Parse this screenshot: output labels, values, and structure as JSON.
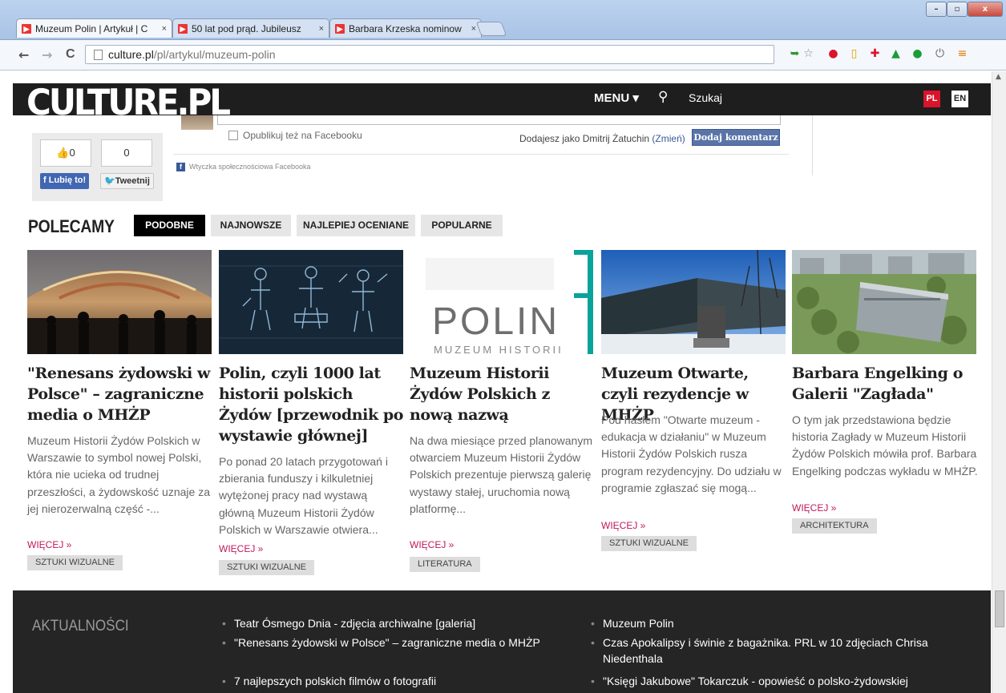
{
  "browser": {
    "tabs": [
      {
        "title": "Muzeum Polin | Artykuł | C",
        "close": "×"
      },
      {
        "title": "50 lat pod prąd. Jubileusz",
        "close": "×"
      },
      {
        "title": "Barbara Krzeska nominow",
        "close": "×"
      }
    ],
    "window_buttons": {
      "minimize": "–",
      "maximize": "▫",
      "close": "x"
    },
    "url": {
      "host": "culture.pl",
      "path": "/pl/artykul/muzeum-polin"
    },
    "nav": {
      "back": "←",
      "forward": "→",
      "reload": "C"
    }
  },
  "site": {
    "logo": "CULTURE.PL",
    "menu_label": "MENU ▾",
    "search_label": "Szukaj",
    "lang_pl": "PL",
    "lang_en": "EN"
  },
  "comments": {
    "facebook_checkbox_label": "Opublikuj też na Facebooku",
    "adding_as": "Dodajesz jako Dmitrij Żatuchin",
    "change_link": "(Zmień)",
    "submit_button": "Dodaj komentarz",
    "plugin_note": "Wtyczka społecznościowa Facebooka"
  },
  "share": {
    "likes_count": "0",
    "tweets_count": "0",
    "like_button": "Lubię to!",
    "tweet_button": "Tweetnij"
  },
  "recommended": {
    "heading": "POLECAMY",
    "tabs": [
      {
        "label": "PODOBNE"
      },
      {
        "label": "NAJNOWSZE"
      },
      {
        "label": "NAJLEPIEJ OCENIANE"
      },
      {
        "label": "POPULARNE"
      }
    ],
    "active_tab": "PODOBNE",
    "cards": [
      {
        "title": "\"Renesans żydowski w Polsce\" – zagraniczne media o MHŻP",
        "description": "Muzeum Historii Żydów Polskich w Warszawie to symbol nowej Polski, która nie ucieka od trudnej przeszłości, a żydowskość uznaje za jej nierozerwalną część -...",
        "more": "WIĘCEJ »",
        "tag": "SZTUKI WIZUALNE"
      },
      {
        "title": "Polin, czyli 1000 lat historii polskich Żydów [przewodnik po wystawie głównej]",
        "description": "Po ponad 20 latach przygotowań i zbierania funduszy i kilkuletniej wytężonej pracy nad wystawą główną Muzeum Historii Żydów Polskich w Warszawie otwiera...",
        "more": "WIĘCEJ »",
        "tag": "SZTUKI WIZUALNE"
      },
      {
        "title": "Muzeum Historii Żydów Polskich z nową nazwą",
        "description": "Na dwa miesiące przed planowanym otwarciem Muzeum Historii Żydów Polskich prezentuje pierwszą galerię wystawy stałej, uruchomia nową platformę...",
        "more": "WIĘCEJ »",
        "tag": "LITERATURA",
        "image_text": "POLIN",
        "image_subtext": "MUZEUM HISTORII"
      },
      {
        "title": "Muzeum Otwarte, czyli rezydencje w MHŻP",
        "description": "Pod hasłem \"Otwarte muzeum - edukacja w działaniu\" w Muzeum Historii Żydów Polskich rusza program rezydencyjny. Do udziału w programie zgłaszać się mogą...",
        "more": "WIĘCEJ »",
        "tag": "SZTUKI WIZUALNE"
      },
      {
        "title": "Barbara Engelking o Galerii \"Zagłada\"",
        "description": "O tym jak przedstawiona będzie historia Zagłady w Muzeum Historii Żydów Polskich mówiła prof. Barbara Engelking podczas wykładu w MHŻP.",
        "more": "WIĘCEJ »",
        "tag": "ARCHITEKTURA"
      }
    ]
  },
  "footer": {
    "heading": "AKTUALNOŚCI",
    "col1": [
      "Teatr Ósmego Dnia - zdjęcia archiwalne [galeria]",
      "\"Renesans żydowski w Polsce\" – zagraniczne media o MHŻP",
      "7 najlepszych polskich filmów o fotografii"
    ],
    "col2": [
      "Muzeum Polin",
      "Czas Apokalipsy i świnie z bagażnika. PRL w 10 zdjęciach Chrisa Niedenthala",
      "\"Księgi Jakubowe\" Tokarczuk - opowieść o polsko-żydowskiej"
    ]
  },
  "colors": {
    "site_header": "#1e1e1e",
    "accent_red": "#d9142b",
    "more_link": "#c2185b",
    "facebook_blue": "#3b5998",
    "twitter_blue": "#1da1f2",
    "footer_bg": "#252525"
  },
  "icons": {
    "page": "page-icon",
    "star": "star-icon",
    "search": "search-icon",
    "thumb": "thumbs-up-icon",
    "facebook": "facebook-icon",
    "twitter": "twitter-icon"
  }
}
